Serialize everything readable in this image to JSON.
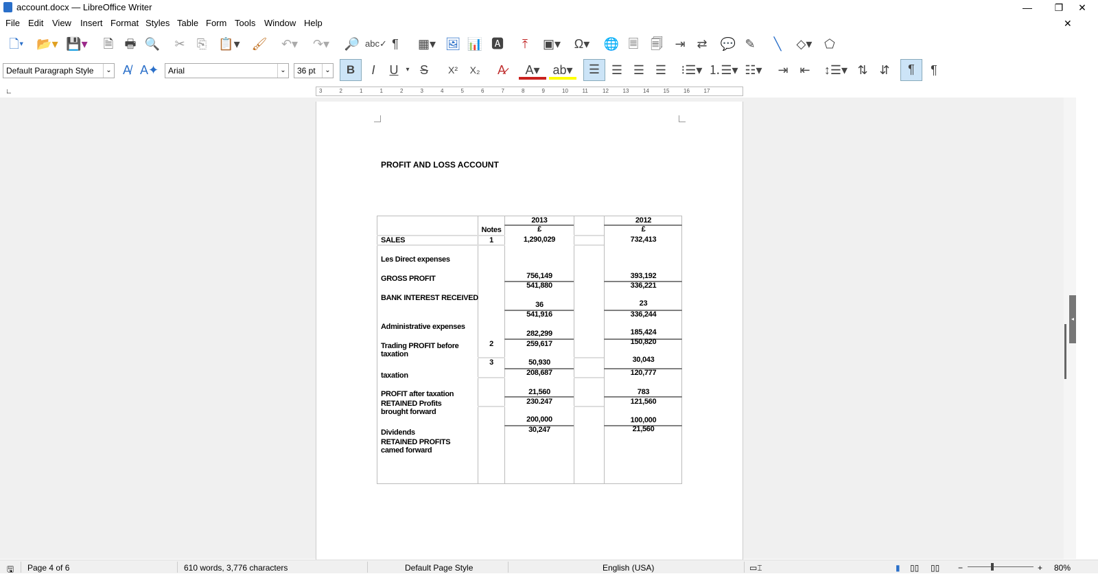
{
  "window": {
    "title": "account.docx — LibreOffice Writer",
    "minimize": "—",
    "maximize": "❐",
    "close": "✕"
  },
  "menu": [
    "File",
    "Edit",
    "View",
    "Insert",
    "Format",
    "Styles",
    "Table",
    "Form",
    "Tools",
    "Window",
    "Help"
  ],
  "formatting": {
    "paragraph_style": "Default Paragraph Style",
    "font_name": "Arial",
    "font_size": "36 pt"
  },
  "toolbar_labels": {
    "bold": "B",
    "italic": "I",
    "underline": "U",
    "strike": "S",
    "superscript": "X²",
    "subscript": "X₂"
  },
  "ruler_ticks": [
    "3",
    "2",
    "1",
    "1",
    "2",
    "3",
    "4",
    "5",
    "6",
    "7",
    "8",
    "9",
    "10",
    "11",
    "12",
    "13",
    "14",
    "15",
    "16",
    "17"
  ],
  "document": {
    "heading": "PROFIT AND LOSS ACCOUNT",
    "table": {
      "year_2013": "2013",
      "year_2012": "2012",
      "notes_header": "Notes",
      "currency_2013": "£",
      "currency_2012": "£",
      "labels": [
        "SALES",
        "Les Direct expenses",
        "GROSS PROFIT",
        "BANK INTEREST RECEIVED",
        "Administrative expenses",
        "Trading PROFIT before taxation",
        "taxation",
        "PROFIT after taxation",
        "RETAINED Profits brought forward",
        "Dividends",
        "RETAINED PROFITS camed forward"
      ],
      "notes": [
        "1",
        "2",
        "3"
      ],
      "values_2013": [
        "1,290,029",
        "756,149",
        "541,880",
        "36",
        "541,916",
        "282,299",
        "259,617",
        "50,930",
        "208,687",
        "21,560",
        "230.247",
        "200,000",
        "30,247"
      ],
      "values_2012": [
        "732,413",
        "393,192",
        "336,221",
        "23",
        "336,244",
        "185,424",
        "150,820",
        "30,043",
        "120,777",
        "783",
        "121,560",
        "100,000",
        "21,560"
      ]
    }
  },
  "status": {
    "page": "Page 4 of 6",
    "words": "610 words, 3,776 characters",
    "page_style": "Default Page Style",
    "language": "English (USA)",
    "zoom": "80%"
  }
}
